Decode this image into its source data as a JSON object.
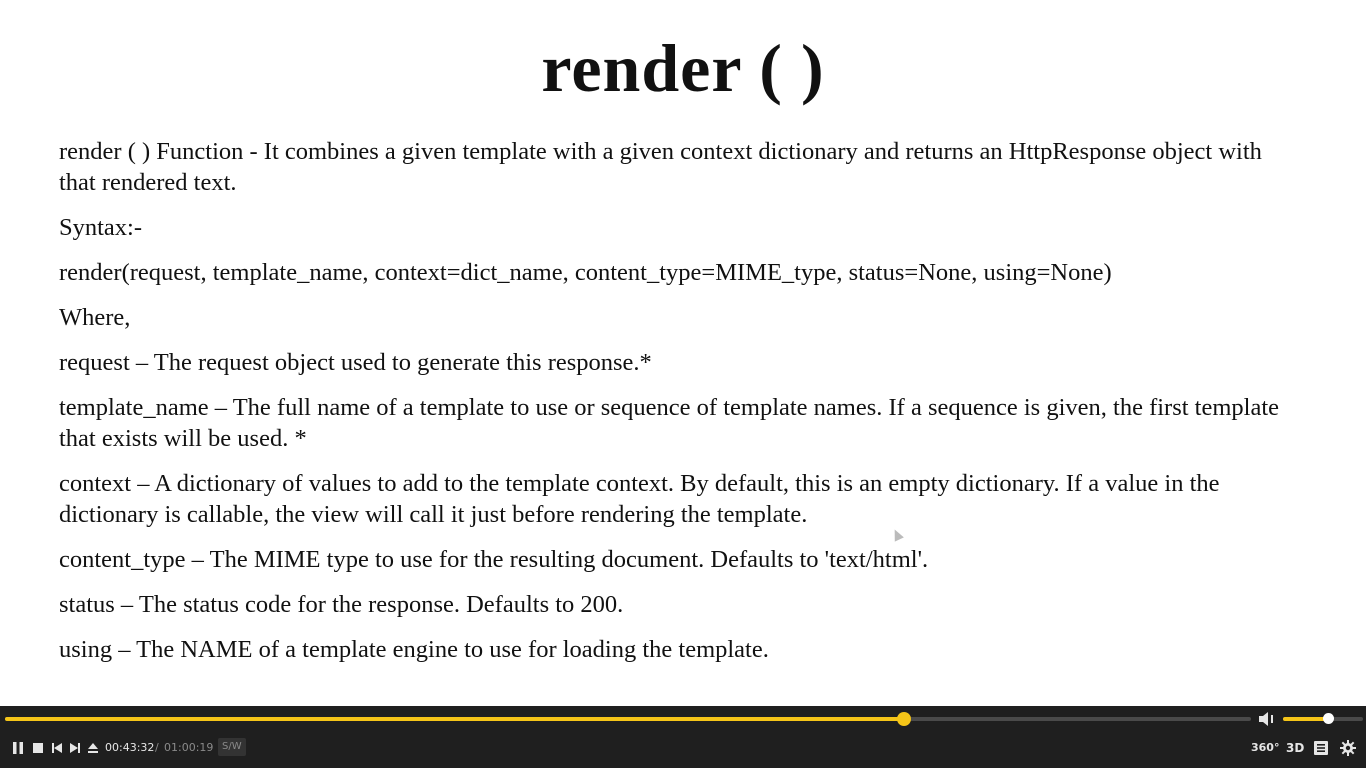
{
  "slide": {
    "title": "render ( )",
    "paragraphs": [
      "render ( ) Function - It combines a given template with a given context dictionary and returns an HttpResponse object with that rendered text.",
      "Syntax:-",
      "render(request, template_name, context=dict_name, content_type=MIME_type, status=None, using=None)",
      "Where,",
      "request – The request object used to generate this response.*",
      "template_name – The full name of a template to use or sequence of template names. If a sequence is given, the first template that exists will be used. *",
      "context – A dictionary of values to add to the template context. By default, this is an empty dictionary. If a value in the dictionary is callable, the view will call it just before rendering the template.",
      "content_type – The MIME type to use for the resulting document. Defaults to 'text/html'.",
      "status – The status code for the response. Defaults to 200.",
      "using – The NAME of a template engine to use for loading the template."
    ]
  },
  "player": {
    "current_time": "00:43:32",
    "separator": "/",
    "duration": "01:00:19",
    "progress_fraction": 0.7217,
    "volume_fraction": 0.56,
    "sw_label": "S/W",
    "vr_label": "360°",
    "three_d_label": "3D",
    "accent_color": "#f5c518",
    "icons": [
      "pause-icon",
      "stop-icon",
      "previous-icon",
      "next-icon",
      "eject-icon",
      "volume-icon",
      "360-icon",
      "3d-icon",
      "playlist-icon",
      "settings-icon"
    ]
  }
}
